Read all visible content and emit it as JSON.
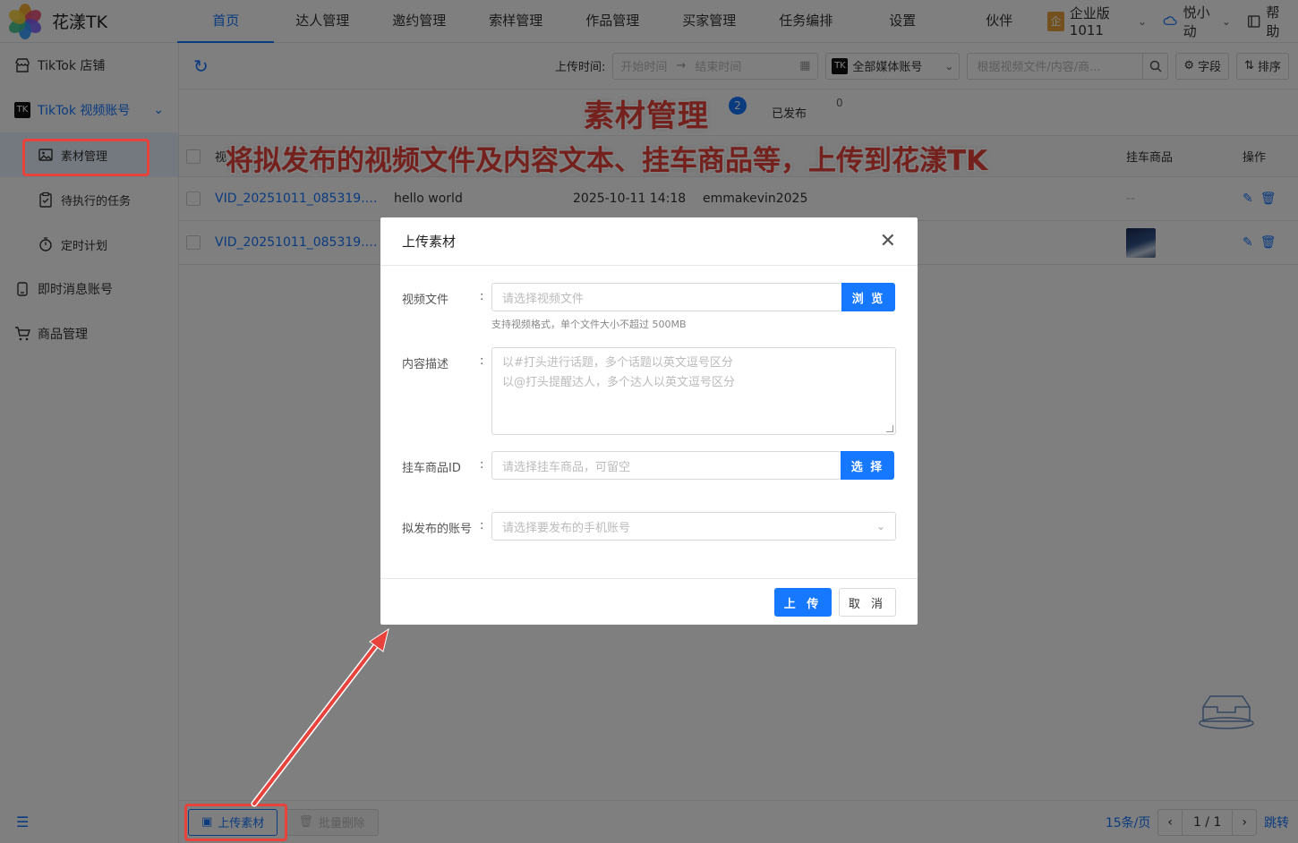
{
  "app": {
    "name": "花漾TK"
  },
  "nav": {
    "items": [
      "首页",
      "达人管理",
      "邀约管理",
      "索样管理",
      "作品管理",
      "买家管理",
      "任务编排",
      "设置",
      "伙伴"
    ],
    "active_index": 0
  },
  "top_right": {
    "edition_badge": "企",
    "edition": "企业版1011",
    "user": "悦小动",
    "help": "帮助"
  },
  "sidebar": {
    "items": [
      {
        "label": "TikTok 店铺",
        "icon": "store-icon"
      },
      {
        "label": "TikTok 视频账号",
        "icon": "tiktok-icon",
        "badge": "TK"
      },
      {
        "label": "素材管理",
        "icon": "image-icon"
      },
      {
        "label": "待执行的任务",
        "icon": "clipboard-icon"
      },
      {
        "label": "定时计划",
        "icon": "stopwatch-icon"
      },
      {
        "label": "即时消息账号",
        "icon": "chat-icon"
      },
      {
        "label": "商品管理",
        "icon": "cart-icon"
      }
    ]
  },
  "toolbar": {
    "upload_time_label": "上传时间:",
    "start_placeholder": "开始时间",
    "range_arrow": "→",
    "end_placeholder": "结束时间",
    "media_badge": "TK",
    "media_select": "全部媒体账号",
    "search_placeholder": "根据视频文件/内容/商...",
    "fields_btn": "字段",
    "sort_btn": "排序"
  },
  "tabs": {
    "active_title": "素材管理",
    "active_count": "2",
    "published_label": "已发布",
    "published_count": "0"
  },
  "table": {
    "col1_partial": "视",
    "headers": {
      "goods": "挂车商品",
      "ops": "操作"
    },
    "rows": [
      {
        "file": "VID_20251011_085319.m...",
        "desc": "hello world",
        "time": "2025-10-11 14:18",
        "account": "emmakevin2025",
        "goods": "--"
      },
      {
        "file": "VID_20251011_085319.m...",
        "desc": "",
        "time": "",
        "account": "",
        "goods": ""
      }
    ]
  },
  "annotation": {
    "title": "素材管理",
    "subtitle": "将拟发布的视频文件及内容文本、挂车商品等，上传到花漾TK"
  },
  "bottom": {
    "upload_btn": "上传素材",
    "batch_delete_btn": "批量删除",
    "page_size": "15条/页",
    "page_info": "1 / 1",
    "jump": "跳转"
  },
  "modal": {
    "title": "上传素材",
    "video_label": "视频文件",
    "colon": ":",
    "video_placeholder": "请选择视频文件",
    "browse_btn": "浏 览",
    "video_hint": "支持视频格式，单个文件大小不超过 500MB",
    "desc_label": "内容描述",
    "desc_placeholder_1": "以#打头进行话题，多个话题以英文逗号区分",
    "desc_placeholder_2": "以@打头提醒达人，多个达人以英文逗号区分",
    "goods_label": "挂车商品ID",
    "goods_placeholder": "请选择挂车商品，可留空",
    "select_btn": "选 择",
    "account_label": "拟发布的账号",
    "account_placeholder": "请选择要发布的手机账号",
    "upload_btn": "上 传",
    "cancel_btn": "取 消"
  },
  "colors": {
    "primary": "#1677ff",
    "annotation_red": "#e8423c",
    "sidebar_selected_bg": "#e8f2ff"
  }
}
